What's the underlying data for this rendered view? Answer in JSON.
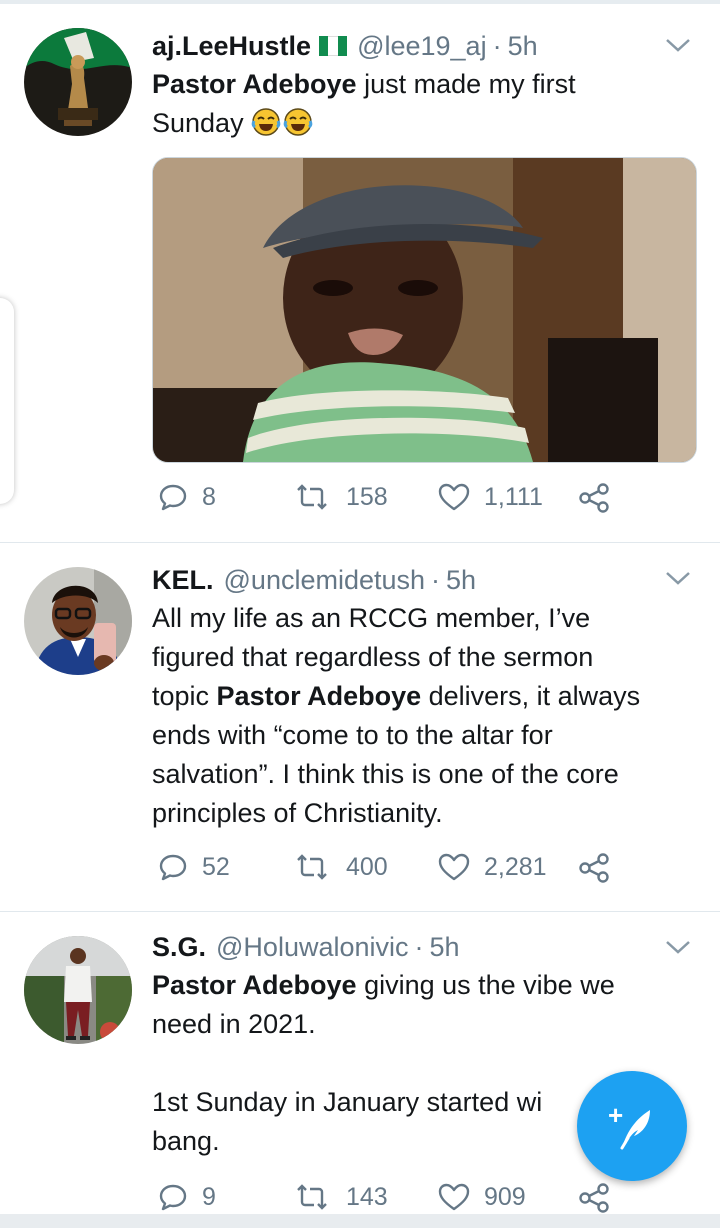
{
  "colors": {
    "accent": "#1da1f2",
    "muted": "#657786",
    "text": "#14171a",
    "divider": "#e1e8ed"
  },
  "tweets": [
    {
      "name": "aj.LeeHustle",
      "flag": "nigeria-flag",
      "handle": "@lee19_aj",
      "sep": "·",
      "time": "5h",
      "text_bold": "Pastor Adeboye",
      "text_1": " just made my first",
      "text_2": "Sunday",
      "emoji": "tears-of-joy-emoji",
      "has_media": true,
      "replies": "8",
      "retweets": "158",
      "likes": "1,111"
    },
    {
      "name": "KEL.",
      "handle": "@unclemidetush",
      "sep": "·",
      "time": "5h",
      "lines": [
        "All my life as an RCCG member, I’ve",
        "figured that regardless of the sermon"
      ],
      "line3_pre": "topic ",
      "line3_bold": "Pastor Adeboye",
      "line3_post": " delivers, it always",
      "lines_after": [
        "ends with “come to to the altar for",
        "salvation”. I think this is one of the core",
        "principles of Christianity."
      ],
      "replies": "52",
      "retweets": "400",
      "likes": "2,281"
    },
    {
      "name": "S.G.",
      "handle": "@Holuwalonivic",
      "sep": "·",
      "time": "5h",
      "text_bold": "Pastor Adeboye",
      "text_1": " giving us the vibe we",
      "text_2": "need in 2021.",
      "text_3": "1st Sunday in January started wi",
      "text_4": "bang.",
      "replies": "9",
      "retweets": "143",
      "likes": "909"
    }
  ],
  "fab": {
    "icon": "compose-tweet-icon",
    "plus": "+"
  }
}
